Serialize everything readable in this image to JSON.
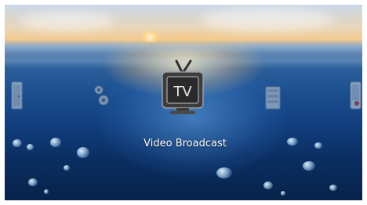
{
  "menu": {
    "selected": {
      "icon": "tv-icon",
      "icon_text": "TV",
      "label": "Video Broadcast"
    },
    "items": [
      {
        "icon": "door-icon"
      },
      {
        "icon": "settings-gears-icon"
      },
      {
        "icon": "tv-icon"
      },
      {
        "icon": "folder-icon"
      },
      {
        "icon": "phone-icon"
      }
    ]
  },
  "colors": {
    "text": "#ffffff",
    "tv_body": "#3d3d3d",
    "tv_screen": "#2a2a2a"
  }
}
